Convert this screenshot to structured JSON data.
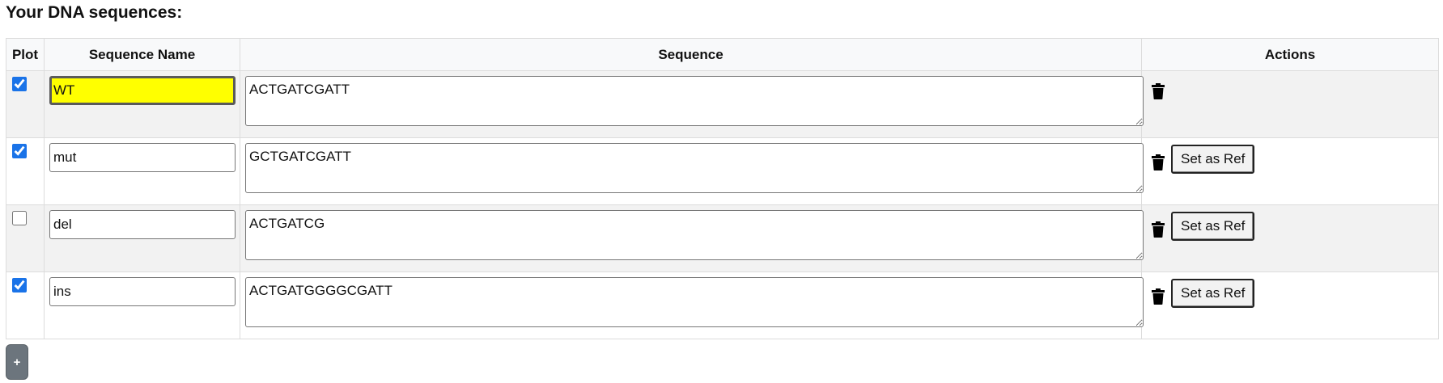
{
  "heading": "Your DNA sequences:",
  "table": {
    "headers": {
      "plot": "Plot",
      "name": "Sequence Name",
      "sequence": "Sequence",
      "actions": "Actions"
    },
    "rows": [
      {
        "plot": true,
        "name": "WT",
        "sequence": "ACTGATCGATT",
        "is_reference": true
      },
      {
        "plot": true,
        "name": "mut",
        "sequence": "GCTGATCGATT",
        "is_reference": false
      },
      {
        "plot": false,
        "name": "del",
        "sequence": "ACTGATCG",
        "is_reference": false
      },
      {
        "plot": true,
        "name": "ins",
        "sequence": "ACTGATGGGGCGATT",
        "is_reference": false
      }
    ],
    "set_ref_label": "Set as Ref",
    "delete_icon": "trash-icon"
  },
  "add_button": {
    "label": "+"
  },
  "colors": {
    "reference_highlight": "#ffff00",
    "checkbox_accent": "#1a73e8",
    "add_button_bg": "#6c757d",
    "odd_row_bg": "#f2f2f2"
  }
}
